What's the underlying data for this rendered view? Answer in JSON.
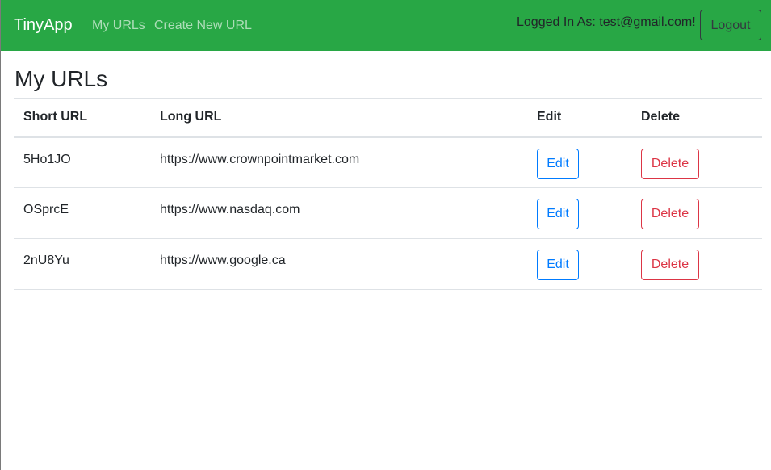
{
  "navbar": {
    "brand": "TinyApp",
    "links": [
      {
        "label": "My URLs"
      },
      {
        "label": "Create New URL"
      }
    ],
    "logged_in_text": "Logged In As: test@gmail.com!",
    "logout_label": "Logout",
    "bg_color": "#28a745"
  },
  "main": {
    "title": "My URLs",
    "table": {
      "headers": [
        "Short URL",
        "Long URL",
        "Edit",
        "Delete"
      ],
      "rows": [
        {
          "short_url": "5Ho1JO",
          "long_url": "https://www.crownpointmarket.com",
          "edit_label": "Edit",
          "delete_label": "Delete"
        },
        {
          "short_url": "OSprcE",
          "long_url": "https://www.nasdaq.com",
          "edit_label": "Edit",
          "delete_label": "Delete"
        },
        {
          "short_url": "2nU8Yu",
          "long_url": "https://www.google.ca",
          "edit_label": "Edit",
          "delete_label": "Delete"
        }
      ]
    }
  },
  "colors": {
    "edit": "#007bff",
    "delete": "#dc3545"
  }
}
